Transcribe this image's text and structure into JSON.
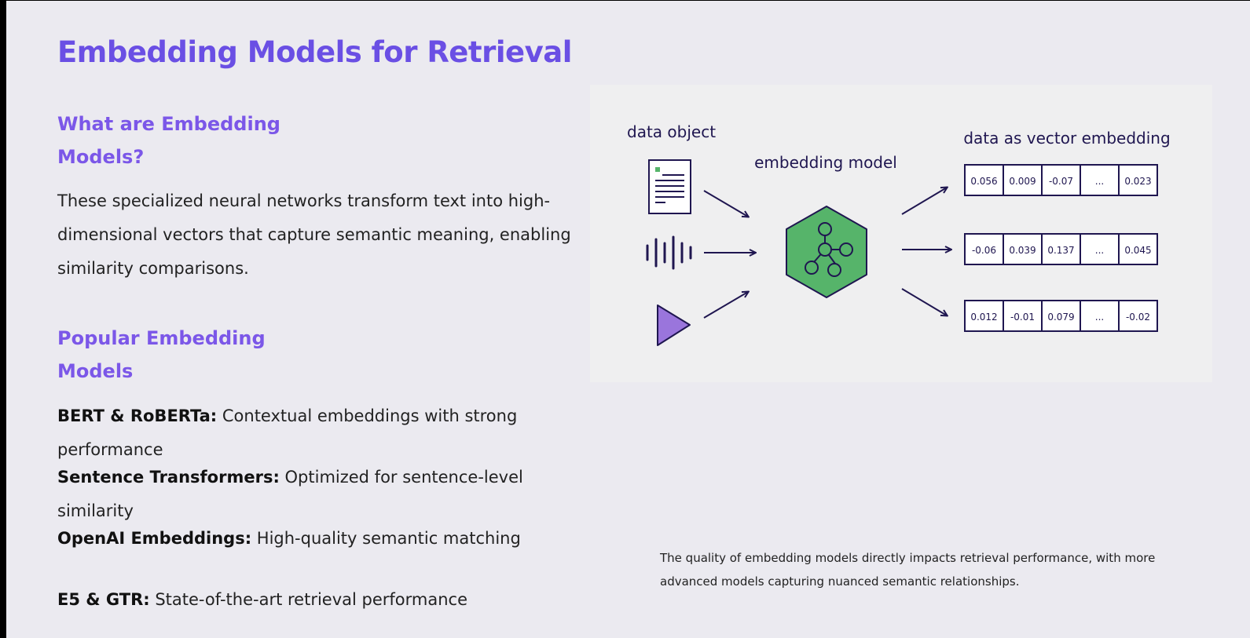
{
  "slide": {
    "title": "Embedding Models for Retrieval",
    "section1": {
      "heading": "What are Embedding Models?",
      "body": "These specialized neural networks transform text into high-dimensional vectors that capture semantic meaning, enabling similarity comparisons."
    },
    "section2": {
      "heading": "Popular Embedding Models",
      "items": [
        {
          "name": "BERT & RoBERTa:",
          "desc": " Contextual embeddings with strong performance"
        },
        {
          "name": "Sentence Transformers:",
          "desc": " Optimized for sentence-level similarity"
        },
        {
          "name": "OpenAI Embeddings:",
          "desc": " High-quality semantic matching"
        },
        {
          "name": "E5 & GTR:",
          "desc": " State-of-the-art retrieval performance"
        }
      ]
    },
    "caption": "The quality of embedding models directly impacts retrieval performance, with more advanced models capturing nuanced semantic relationships."
  },
  "diagram": {
    "label_input": "data object",
    "label_model": "embedding model",
    "label_output": "data as vector embedding",
    "vectors": [
      [
        "0.056",
        "0.009",
        "-0.07",
        "...",
        "0.023"
      ],
      [
        "-0.06",
        "0.039",
        "0.137",
        "...",
        "0.045"
      ],
      [
        "0.012",
        "-0.01",
        "0.079",
        "...",
        "-0.02"
      ]
    ],
    "inputs": [
      "document-icon",
      "audio-waveform-icon",
      "play-video-icon"
    ],
    "colors": {
      "ink": "#1f1650",
      "model_fill": "#56b46a",
      "play_fill": "#9a75dc",
      "accent": "#6a4fe4"
    }
  }
}
